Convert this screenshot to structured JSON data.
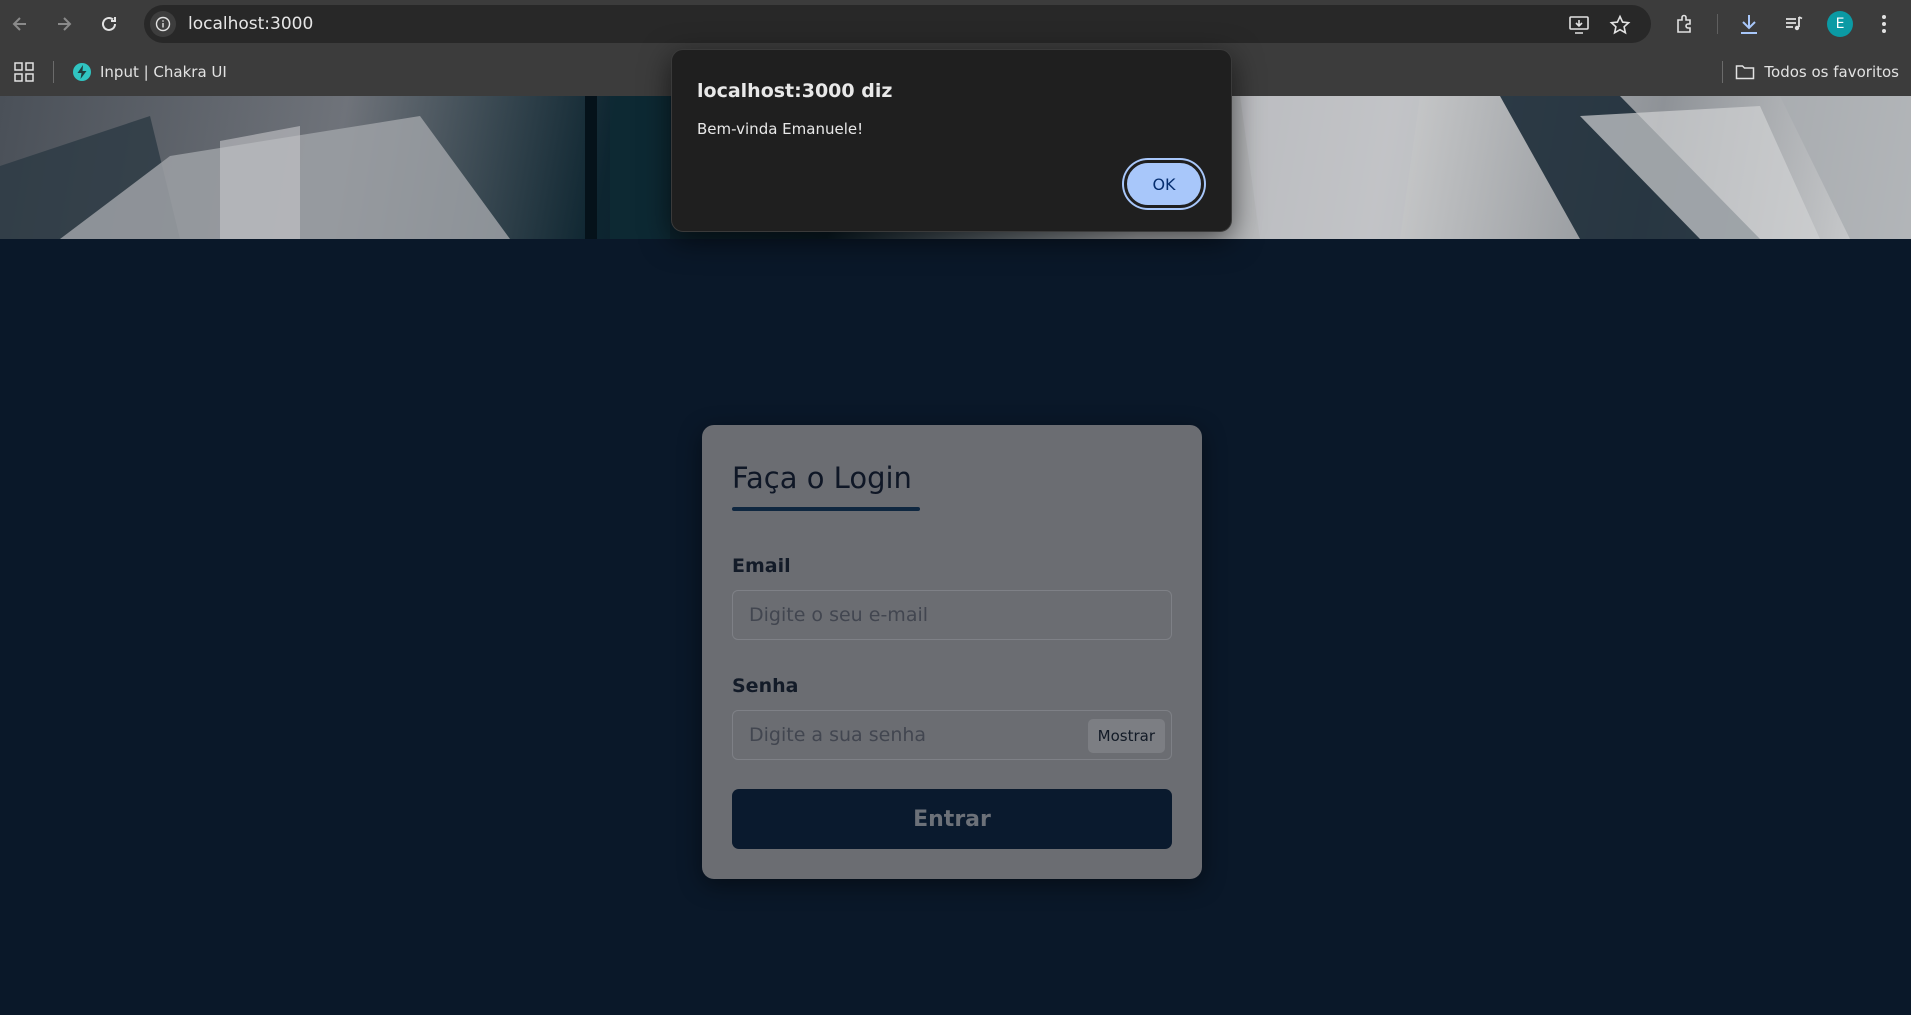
{
  "browser": {
    "url": "localhost:3000",
    "bookmarks": [
      {
        "label": "Input | Chakra UI",
        "icon": "chakra-logo-icon"
      }
    ],
    "all_bookmarks_label": "Todos os favoritos",
    "profile_initial": "E",
    "colors": {
      "toolbar": "#3c3c3c",
      "omnibox": "#282828",
      "avatar": "#0b9aa4"
    }
  },
  "alert": {
    "title": "localhost:3000 diz",
    "message": "Bem-vinda Emanuele!",
    "ok_label": "OK",
    "colors": {
      "ok_bg": "#a8c7fa",
      "ok_text": "#062e6f"
    }
  },
  "login": {
    "title": "Faça o Login",
    "email_label": "Email",
    "email_placeholder": "Digite o seu e-mail",
    "password_label": "Senha",
    "password_placeholder": "Digite a sua senha",
    "show_label": "Mostrar",
    "submit_label": "Entrar",
    "colors": {
      "page_bg": "#0a1829",
      "card_bg": "#6b6d72",
      "button_bg": "#0a1a2e"
    }
  }
}
